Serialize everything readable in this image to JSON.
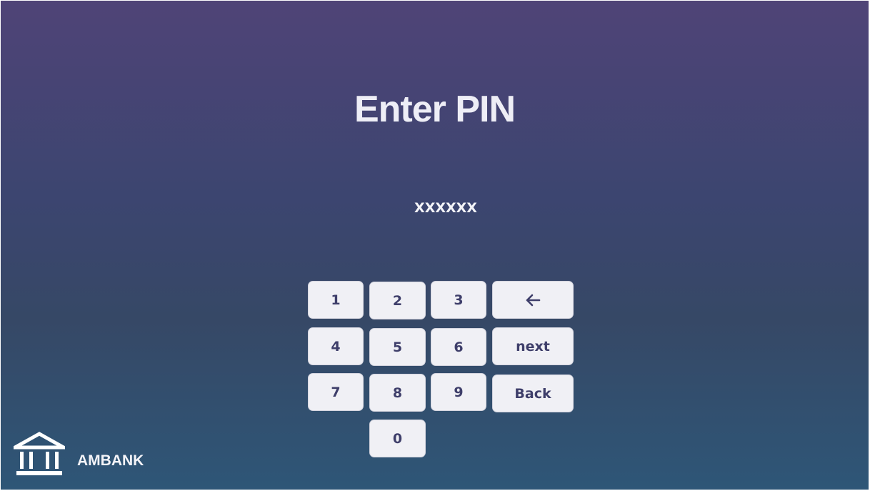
{
  "screen": {
    "title": "Enter PIN",
    "pin_mask": "XXXXXX"
  },
  "keypad": {
    "keys": [
      "1",
      "2",
      "3",
      "4",
      "5",
      "6",
      "7",
      "8",
      "9",
      "0"
    ],
    "backspace_icon": "arrow-left-icon",
    "next_label": "next",
    "back_label": "Back"
  },
  "footer": {
    "logo_icon": "bank-building-icon",
    "brand_name": "AMBANK"
  },
  "colors": {
    "background_top": "#4f4477",
    "background_bottom": "#2e5677",
    "key_fill": "#f0f0f5",
    "key_text": "#3e3e6a",
    "title_text": "#eeeef6"
  }
}
